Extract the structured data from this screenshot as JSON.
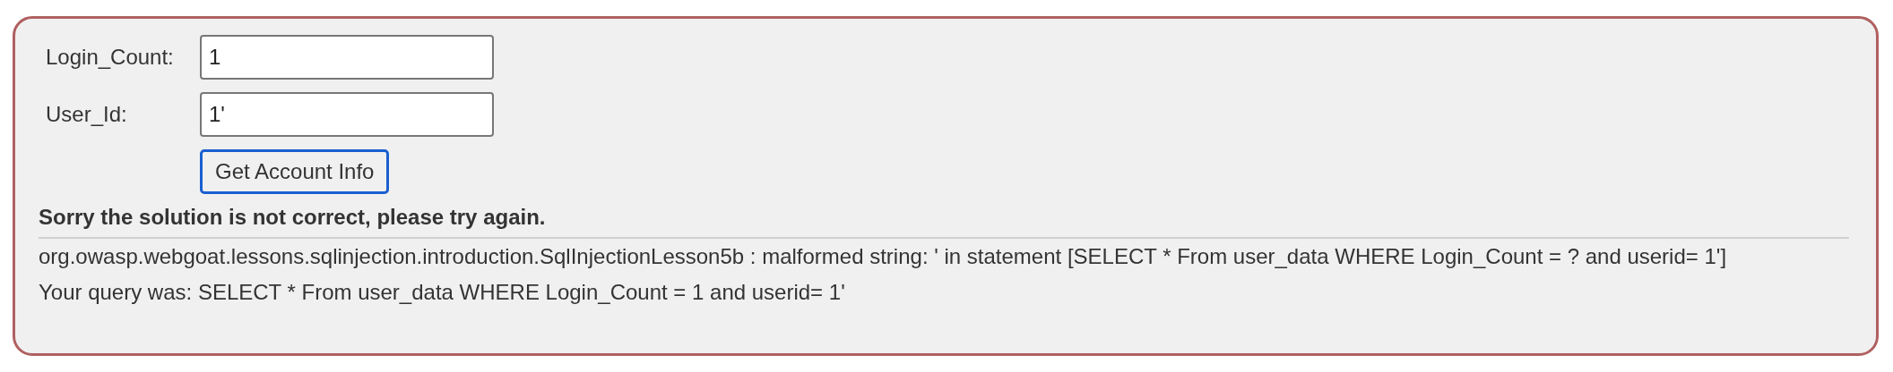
{
  "form": {
    "fields": [
      {
        "label": "Login_Count:",
        "value": "1"
      },
      {
        "label": "User_Id:",
        "value": "1'"
      }
    ],
    "button": "Get Account Info"
  },
  "feedback": {
    "title": "Sorry the solution is not correct, please try again.",
    "lines": [
      "org.owasp.webgoat.lessons.sqlinjection.introduction.SqlInjectionLesson5b : malformed string: ' in statement [SELECT * From user_data WHERE Login_Count = ? and userid= 1']",
      "Your query was: SELECT * From user_data WHERE Login_Count = 1 and userid= 1'"
    ]
  }
}
